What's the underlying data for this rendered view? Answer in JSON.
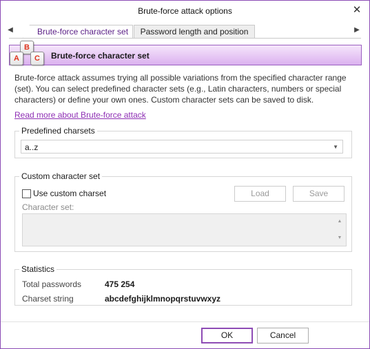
{
  "window": {
    "title": "Brute-force attack options"
  },
  "tabs": [
    {
      "label": "Brute-force character set",
      "active": true
    },
    {
      "label": "Password length and position",
      "active": false
    }
  ],
  "icons": {
    "close": "close-icon",
    "tab_left": "chevron-left-icon",
    "tab_right": "chevron-right-icon",
    "abc": "abc-keys-icon"
  },
  "banner": {
    "title": "Brute-force character set",
    "icon_letters": {
      "top": "B",
      "left": "A",
      "right": "C"
    }
  },
  "description": "Brute-force attack assumes trying all possible variations from the specified character range (set). You can select predefined character sets (e.g., Latin characters, numbers or special characters) or define your own ones. Custom character sets can be saved to disk.",
  "read_more": "Read more about Brute-force attack",
  "predefined": {
    "legend": "Predefined charsets",
    "selected": "a..z"
  },
  "custom": {
    "legend": "Custom character set",
    "checkbox_label": "Use custom charset",
    "checked": false,
    "load_label": "Load",
    "save_label": "Save",
    "charset_label": "Character set:",
    "charset_value": ""
  },
  "stats": {
    "legend": "Statistics",
    "total_label": "Total passwords",
    "total_value": "475 254",
    "charset_label": "Charset string",
    "charset_value": "abcdefghijklmnopqrstuvwxyz"
  },
  "footer": {
    "ok_label": "OK",
    "cancel_label": "Cancel"
  },
  "colors": {
    "accent": "#8e4bb5",
    "link": "#8e2fb4",
    "banner_top": "#f5e6fb",
    "banner_bottom": "#dab1ef",
    "icon_letter": "#e0341f"
  }
}
